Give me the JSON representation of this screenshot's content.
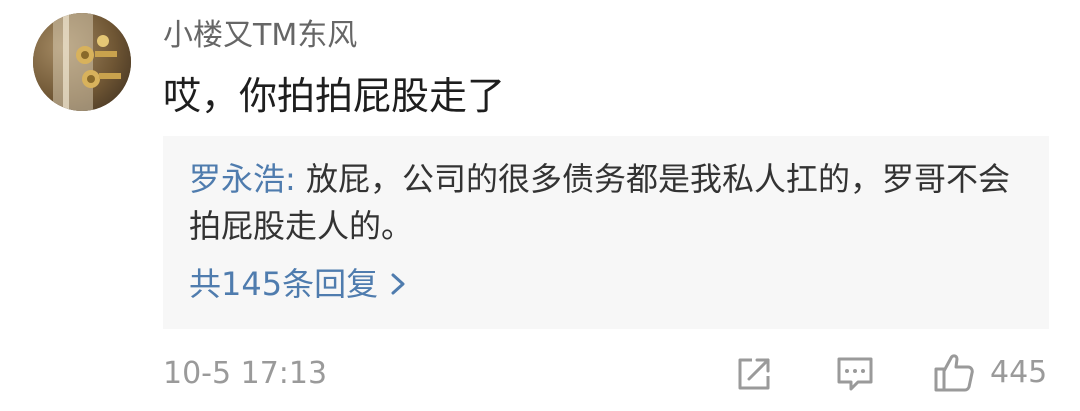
{
  "comment": {
    "username": "小楼又TM东风",
    "text": "哎，你拍拍屁股走了",
    "avatar_icon": "avatar",
    "timestamp": "10-5 17:13"
  },
  "reply_preview": {
    "author": "罗永浩",
    "separator": ":",
    "text": "放屁，公司的很多债务都是我私人扛的，罗哥不会拍屁股走人的。",
    "replies_link": "共145条回复",
    "link_icon": "chevron-right-icon"
  },
  "actions": {
    "share_icon": "share-icon",
    "comment_icon": "comment-icon",
    "like_icon": "thumbs-up-icon",
    "like_count": "445"
  },
  "colors": {
    "link": "#4f7cae",
    "muted": "#9a9a9a",
    "reply_background": "#f7f7f7"
  }
}
